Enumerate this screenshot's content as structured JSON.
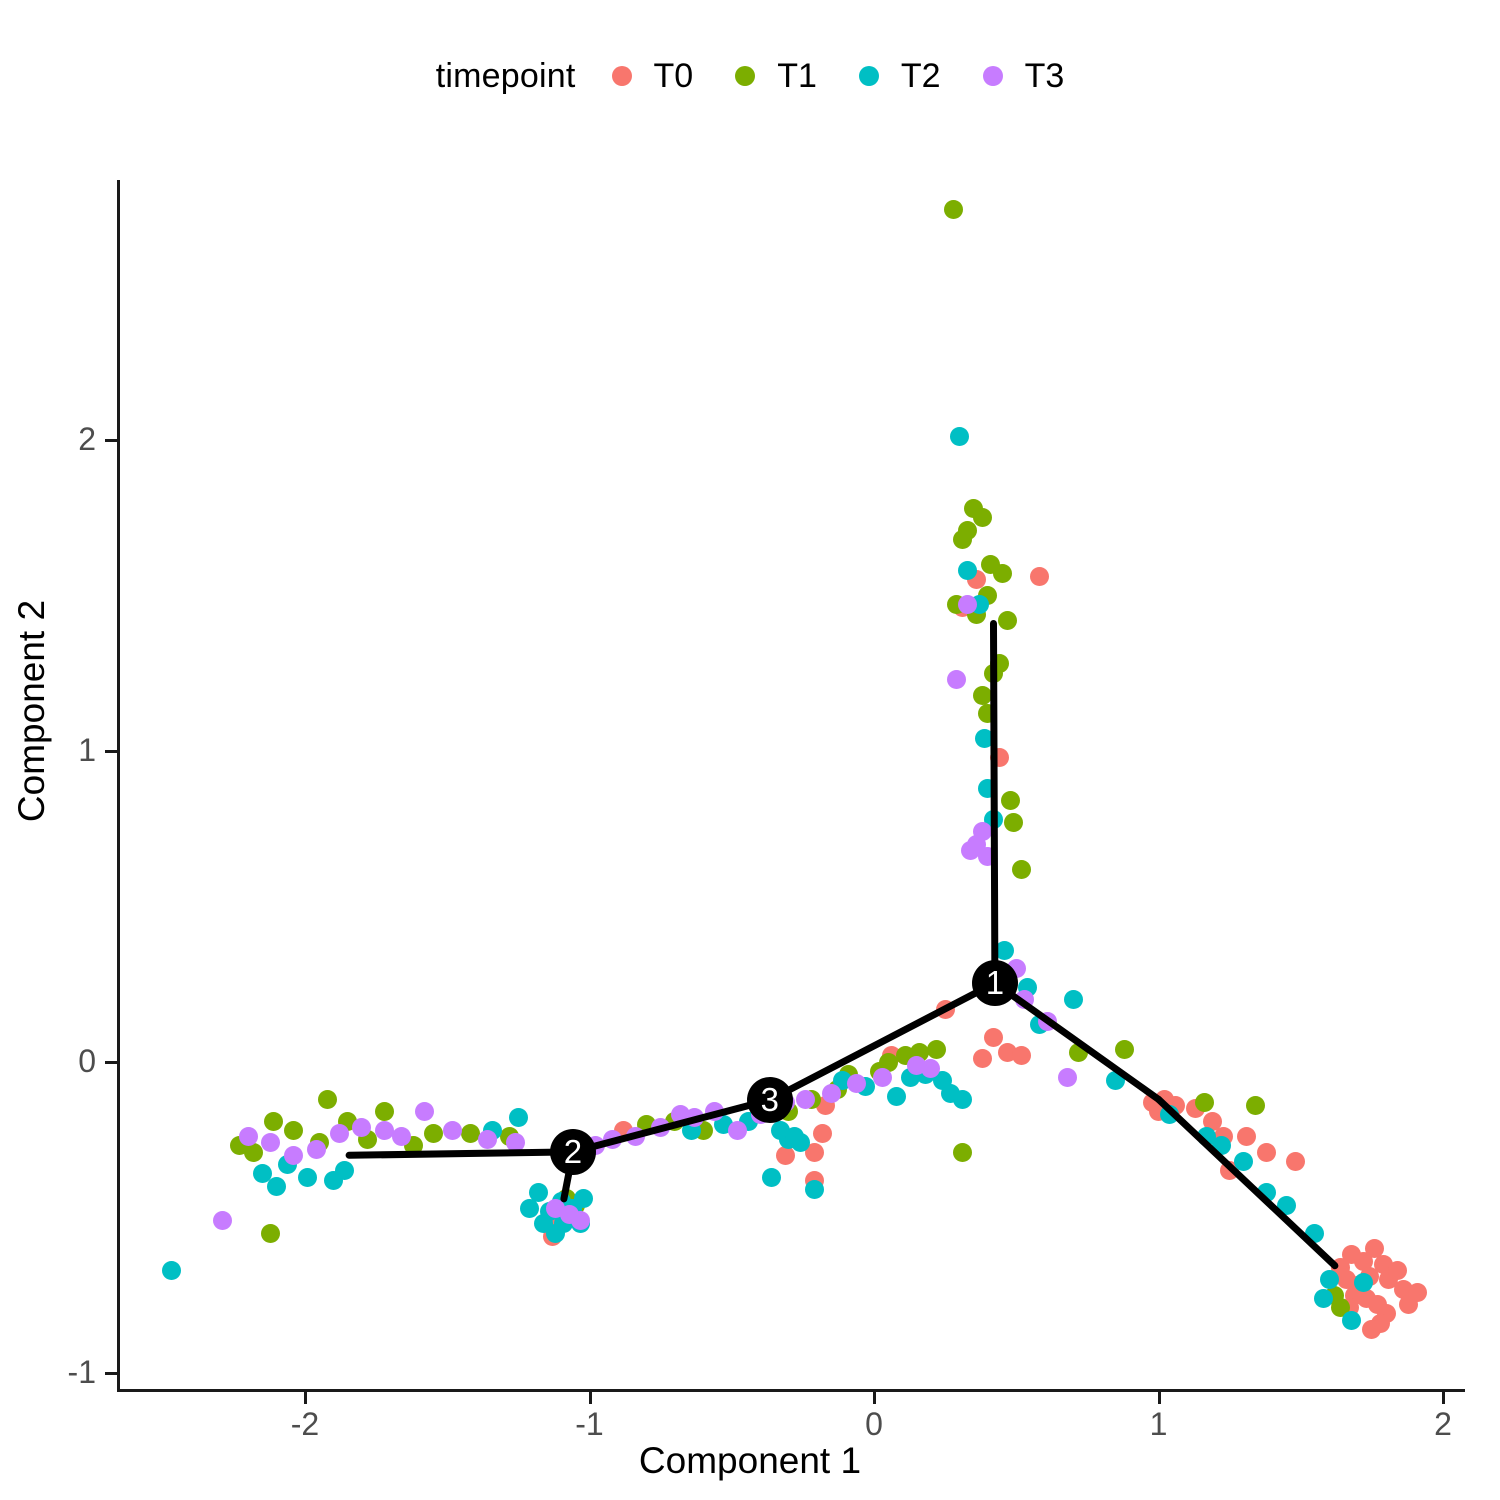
{
  "legend": {
    "title": "timepoint",
    "items": [
      {
        "label": "T0",
        "color": "#F8766D"
      },
      {
        "label": "T1",
        "color": "#7CAE00"
      },
      {
        "label": "T2",
        "color": "#00BFC4"
      },
      {
        "label": "T3",
        "color": "#C77CFF"
      }
    ]
  },
  "axes": {
    "x_title": "Component 1",
    "y_title": "Component 2",
    "x_ticks": [
      {
        "label": "-2",
        "value": -2
      },
      {
        "label": "-1",
        "value": -1
      },
      {
        "label": "0",
        "value": 0
      },
      {
        "label": "1",
        "value": 1
      },
      {
        "label": "2",
        "value": 2
      }
    ],
    "y_ticks": [
      {
        "label": "-1",
        "value": -1
      },
      {
        "label": "0",
        "value": 0
      },
      {
        "label": "1",
        "value": 1
      },
      {
        "label": "2",
        "value": 2
      }
    ]
  },
  "chart_data": {
    "type": "scatter",
    "title": "",
    "xlabel": "Component 1",
    "ylabel": "Component 2",
    "xlim": [
      -2.66,
      2.08
    ],
    "ylim": [
      -1.06,
      2.89
    ],
    "grid": false,
    "legend_position": "top",
    "legend_title": "timepoint",
    "colors": {
      "T0": "#F8766D",
      "T1": "#7CAE00",
      "T2": "#00BFC4",
      "T3": "#C77CFF"
    },
    "series": [
      {
        "name": "T0",
        "color": "#F8766D",
        "points": [
          [
            0.36,
            1.55
          ],
          [
            0.31,
            1.46
          ],
          [
            0.58,
            1.56
          ],
          [
            0.44,
            0.98
          ],
          [
            0.42,
            0.08
          ],
          [
            0.25,
            0.17
          ],
          [
            0.47,
            0.03
          ],
          [
            0.52,
            0.02
          ],
          [
            0.38,
            0.01
          ],
          [
            0.06,
            0.02
          ],
          [
            -0.17,
            -0.14
          ],
          [
            -0.18,
            -0.23
          ],
          [
            -0.21,
            -0.38
          ],
          [
            -0.21,
            -0.29
          ],
          [
            -0.31,
            -0.3
          ],
          [
            -0.88,
            -0.22
          ],
          [
            -1.13,
            -0.56
          ],
          [
            -1.11,
            -0.5
          ],
          [
            -1.07,
            -0.49
          ],
          [
            0.98,
            -0.13
          ],
          [
            1.02,
            -0.12
          ],
          [
            1.06,
            -0.14
          ],
          [
            1.13,
            -0.15
          ],
          [
            1.0,
            -0.16
          ],
          [
            1.19,
            -0.19
          ],
          [
            1.23,
            -0.24
          ],
          [
            1.31,
            -0.24
          ],
          [
            1.38,
            -0.29
          ],
          [
            1.25,
            -0.35
          ],
          [
            1.48,
            -0.32
          ],
          [
            1.68,
            -0.62
          ],
          [
            1.72,
            -0.64
          ],
          [
            1.76,
            -0.6
          ],
          [
            1.79,
            -0.65
          ],
          [
            1.74,
            -0.69
          ],
          [
            1.81,
            -0.7
          ],
          [
            1.84,
            -0.67
          ],
          [
            1.86,
            -0.73
          ],
          [
            1.7,
            -0.72
          ],
          [
            1.73,
            -0.76
          ],
          [
            1.77,
            -0.78
          ],
          [
            1.8,
            -0.81
          ],
          [
            1.66,
            -0.7
          ],
          [
            1.69,
            -0.75
          ],
          [
            1.64,
            -0.66
          ],
          [
            1.88,
            -0.78
          ],
          [
            1.91,
            -0.74
          ],
          [
            1.78,
            -0.84
          ],
          [
            1.75,
            -0.86
          ],
          [
            1.67,
            -0.79
          ]
        ]
      },
      {
        "name": "T1",
        "color": "#7CAE00",
        "points": [
          [
            0.28,
            2.74
          ],
          [
            0.35,
            1.78
          ],
          [
            0.38,
            1.75
          ],
          [
            0.33,
            1.71
          ],
          [
            0.31,
            1.68
          ],
          [
            0.41,
            1.6
          ],
          [
            0.45,
            1.57
          ],
          [
            0.4,
            1.5
          ],
          [
            0.29,
            1.47
          ],
          [
            0.36,
            1.44
          ],
          [
            0.47,
            1.42
          ],
          [
            0.44,
            1.28
          ],
          [
            0.42,
            1.25
          ],
          [
            0.38,
            1.18
          ],
          [
            0.4,
            1.12
          ],
          [
            0.48,
            0.84
          ],
          [
            0.49,
            0.77
          ],
          [
            0.52,
            0.62
          ],
          [
            0.31,
            -0.29
          ],
          [
            -0.35,
            -0.14
          ],
          [
            -0.3,
            -0.16
          ],
          [
            -0.22,
            -0.12
          ],
          [
            -0.13,
            -0.09
          ],
          [
            -0.09,
            -0.04
          ],
          [
            0.02,
            -0.03
          ],
          [
            0.05,
            0.0
          ],
          [
            0.11,
            0.02
          ],
          [
            0.16,
            0.03
          ],
          [
            0.22,
            0.04
          ],
          [
            -0.6,
            -0.22
          ],
          [
            -0.7,
            -0.19
          ],
          [
            -0.8,
            -0.2
          ],
          [
            -1.05,
            -0.46
          ],
          [
            -1.08,
            -0.44
          ],
          [
            -1.28,
            -0.24
          ],
          [
            -1.42,
            -0.23
          ],
          [
            -1.55,
            -0.23
          ],
          [
            -1.62,
            -0.27
          ],
          [
            -1.72,
            -0.16
          ],
          [
            -1.78,
            -0.25
          ],
          [
            -1.85,
            -0.19
          ],
          [
            -1.95,
            -0.26
          ],
          [
            -2.04,
            -0.22
          ],
          [
            -2.11,
            -0.19
          ],
          [
            -2.18,
            -0.29
          ],
          [
            -2.23,
            -0.27
          ],
          [
            -2.12,
            -0.55
          ],
          [
            -1.92,
            -0.12
          ],
          [
            0.72,
            0.03
          ],
          [
            0.88,
            0.04
          ],
          [
            1.16,
            -0.13
          ],
          [
            1.34,
            -0.14
          ],
          [
            1.62,
            -0.75
          ],
          [
            1.64,
            -0.79
          ]
        ]
      },
      {
        "name": "T2",
        "color": "#00BFC4",
        "points": [
          [
            0.3,
            2.01
          ],
          [
            0.33,
            1.58
          ],
          [
            0.37,
            1.47
          ],
          [
            0.4,
            0.88
          ],
          [
            0.42,
            0.78
          ],
          [
            0.39,
            1.04
          ],
          [
            0.46,
            0.36
          ],
          [
            0.54,
            0.24
          ],
          [
            0.7,
            0.2
          ],
          [
            0.58,
            0.12
          ],
          [
            0.18,
            -0.04
          ],
          [
            0.13,
            -0.05
          ],
          [
            0.24,
            -0.06
          ],
          [
            0.27,
            -0.1
          ],
          [
            0.31,
            -0.12
          ],
          [
            0.08,
            -0.11
          ],
          [
            -0.03,
            -0.08
          ],
          [
            -0.11,
            -0.06
          ],
          [
            -0.44,
            -0.19
          ],
          [
            -0.33,
            -0.22
          ],
          [
            -0.3,
            -0.25
          ],
          [
            -0.28,
            -0.24
          ],
          [
            -0.26,
            -0.26
          ],
          [
            -0.36,
            -0.37
          ],
          [
            -0.21,
            -0.41
          ],
          [
            -0.53,
            -0.2
          ],
          [
            -0.64,
            -0.22
          ],
          [
            -1.14,
            -0.48
          ],
          [
            -1.1,
            -0.45
          ],
          [
            -1.06,
            -0.47
          ],
          [
            -1.09,
            -0.52
          ],
          [
            -1.03,
            -0.52
          ],
          [
            -1.16,
            -0.52
          ],
          [
            -1.12,
            -0.55
          ],
          [
            -1.18,
            -0.42
          ],
          [
            -1.02,
            -0.44
          ],
          [
            -1.21,
            -0.47
          ],
          [
            -1.25,
            -0.18
          ],
          [
            -1.34,
            -0.22
          ],
          [
            -1.86,
            -0.35
          ],
          [
            -1.9,
            -0.38
          ],
          [
            -1.99,
            -0.37
          ],
          [
            -2.06,
            -0.33
          ],
          [
            -2.1,
            -0.4
          ],
          [
            -2.15,
            -0.36
          ],
          [
            -2.47,
            -0.67
          ],
          [
            0.85,
            -0.06
          ],
          [
            1.04,
            -0.17
          ],
          [
            1.17,
            -0.24
          ],
          [
            1.22,
            -0.27
          ],
          [
            1.3,
            -0.32
          ],
          [
            1.38,
            -0.42
          ],
          [
            1.45,
            -0.46
          ],
          [
            1.55,
            -0.55
          ],
          [
            1.6,
            -0.7
          ],
          [
            1.68,
            -0.83
          ],
          [
            1.72,
            -0.71
          ],
          [
            1.58,
            -0.76
          ]
        ]
      },
      {
        "name": "T3",
        "color": "#C77CFF",
        "points": [
          [
            0.33,
            1.47
          ],
          [
            0.29,
            1.23
          ],
          [
            0.38,
            0.74
          ],
          [
            0.36,
            0.7
          ],
          [
            0.34,
            0.68
          ],
          [
            0.4,
            0.66
          ],
          [
            0.5,
            0.3
          ],
          [
            0.53,
            0.2
          ],
          [
            0.61,
            0.13
          ],
          [
            0.68,
            -0.05
          ],
          [
            0.2,
            -0.02
          ],
          [
            0.15,
            -0.01
          ],
          [
            0.03,
            -0.05
          ],
          [
            -0.06,
            -0.07
          ],
          [
            -0.15,
            -0.1
          ],
          [
            -0.24,
            -0.12
          ],
          [
            -0.31,
            -0.13
          ],
          [
            -0.4,
            -0.17
          ],
          [
            -0.48,
            -0.22
          ],
          [
            -0.56,
            -0.16
          ],
          [
            -0.63,
            -0.18
          ],
          [
            -0.68,
            -0.17
          ],
          [
            -0.75,
            -0.21
          ],
          [
            -0.84,
            -0.24
          ],
          [
            -0.92,
            -0.25
          ],
          [
            -0.98,
            -0.27
          ],
          [
            -1.04,
            -0.29
          ],
          [
            -1.07,
            -0.49
          ],
          [
            -1.03,
            -0.51
          ],
          [
            -1.12,
            -0.47
          ],
          [
            -1.26,
            -0.26
          ],
          [
            -1.36,
            -0.25
          ],
          [
            -1.48,
            -0.22
          ],
          [
            -1.58,
            -0.16
          ],
          [
            -1.66,
            -0.24
          ],
          [
            -1.72,
            -0.22
          ],
          [
            -1.8,
            -0.21
          ],
          [
            -1.88,
            -0.23
          ],
          [
            -1.96,
            -0.28
          ],
          [
            -2.04,
            -0.3
          ],
          [
            -2.12,
            -0.26
          ],
          [
            -2.2,
            -0.24
          ],
          [
            -2.29,
            -0.51
          ]
        ]
      }
    ],
    "tree": {
      "nodes": [
        {
          "id": "1",
          "x": 0.425,
          "y": 0.254
        },
        {
          "id": "2",
          "x": -1.058,
          "y": -0.289
        },
        {
          "id": "3",
          "x": -0.366,
          "y": -0.122
        }
      ],
      "edges": [
        [
          [
            0.42,
            1.41
          ],
          [
            0.425,
            0.254
          ]
        ],
        [
          [
            0.425,
            0.254
          ],
          [
            -0.366,
            -0.122
          ]
        ],
        [
          [
            -0.366,
            -0.122
          ],
          [
            -1.058,
            -0.289
          ]
        ],
        [
          [
            -1.058,
            -0.289
          ],
          [
            -1.845,
            -0.3
          ]
        ],
        [
          [
            -1.058,
            -0.289
          ],
          [
            -1.09,
            -0.44
          ]
        ],
        [
          [
            0.425,
            0.254
          ],
          [
            1.0,
            -0.12
          ]
        ],
        [
          [
            1.0,
            -0.12
          ],
          [
            1.62,
            -0.655
          ]
        ]
      ]
    }
  }
}
